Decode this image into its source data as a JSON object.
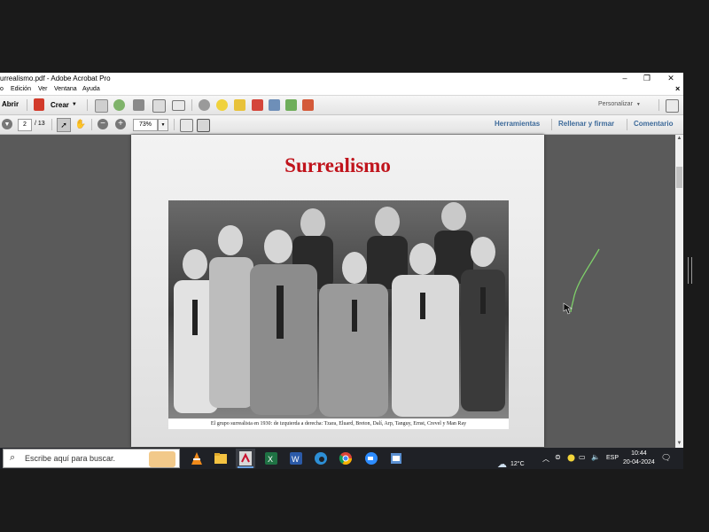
{
  "window": {
    "title": "urrealismo.pdf - Adobe Acrobat Pro",
    "minimize_glyph": "–",
    "maximize_glyph": "❐",
    "close_glyph": "✕"
  },
  "menu": {
    "items": [
      "o",
      "Edición",
      "Ver",
      "Ventana",
      "Ayuda"
    ],
    "close_doc": "×"
  },
  "toolbar": {
    "open_label": "Abrir",
    "create_label": "Crear",
    "customize_label": "Personalizar"
  },
  "nav": {
    "current_page": "2",
    "total_pages": "/ 13",
    "zoom": "73%",
    "tools_label": "Herramientas",
    "fill_sign_label": "Rellenar y firmar",
    "comment_label": "Comentario"
  },
  "document": {
    "page_title": "Surrealismo",
    "photo_caption": "El grupo surrealista en 1930: de izquierda a derecha: Tzara, Eluard, Breton, Dalí, Arp, Tanguy, Ernst, Crevel y Man Ray"
  },
  "taskbar": {
    "search_placeholder": "Escribe aquí para buscar.",
    "weather": "12°C",
    "language": "ESP",
    "time": "10:44",
    "date": "20-04-2024"
  },
  "colors": {
    "title_red": "#c0141c",
    "link_blue": "#3d6a9a",
    "doc_background": "#5a5a5a",
    "taskbar": "#1f2126"
  }
}
